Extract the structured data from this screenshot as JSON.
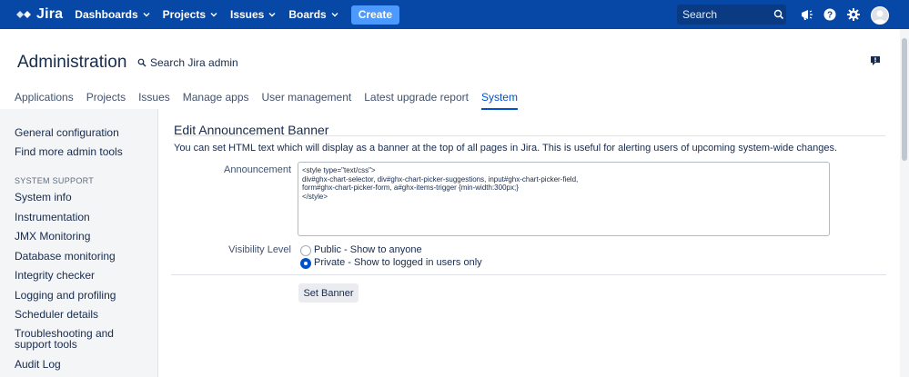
{
  "nav": {
    "logo_text": "Jira",
    "items": [
      {
        "label": "Dashboards"
      },
      {
        "label": "Projects"
      },
      {
        "label": "Issues"
      },
      {
        "label": "Boards"
      }
    ],
    "create_label": "Create",
    "search_placeholder": "Search"
  },
  "header": {
    "title": "Administration",
    "search_admin": "Search Jira admin",
    "tabs": [
      {
        "label": "Applications"
      },
      {
        "label": "Projects"
      },
      {
        "label": "Issues"
      },
      {
        "label": "Manage apps"
      },
      {
        "label": "User management"
      },
      {
        "label": "Latest upgrade report"
      },
      {
        "label": "System",
        "active": true
      }
    ]
  },
  "sidebar": {
    "top_links": [
      "General configuration",
      "Find more admin tools"
    ],
    "section_heading": "SYSTEM SUPPORT",
    "support_links": [
      "System info",
      "Instrumentation",
      "JMX Monitoring",
      "Database monitoring",
      "Integrity checker",
      "Logging and profiling",
      "Scheduler details",
      "Troubleshooting and support tools",
      "Audit Log"
    ]
  },
  "main": {
    "title": "Edit Announcement Banner",
    "description": "You can set HTML text which will display as a banner at the top of all pages in Jira. This is useful for alerting users of upcoming system-wide changes.",
    "announcement_label": "Announcement",
    "announcement_value": "<style type=\"text/css\">\ndiv#ghx-chart-selector, div#ghx-chart-picker-suggestions, input#ghx-chart-picker-field,\nform#ghx-chart-picker-form, a#ghx-items-trigger {min-width:300px;}\n</style>",
    "visibility_label": "Visibility Level",
    "visibility_options": [
      {
        "label": "Public - Show to anyone",
        "selected": false
      },
      {
        "label": "Private - Show to logged in users only",
        "selected": true
      }
    ],
    "submit_label": "Set Banner"
  },
  "colors": {
    "nav_bg": "#0747a6",
    "create_bg": "#4c9aff",
    "link_active": "#0052cc",
    "sidebar_bg": "#f4f5f7"
  }
}
